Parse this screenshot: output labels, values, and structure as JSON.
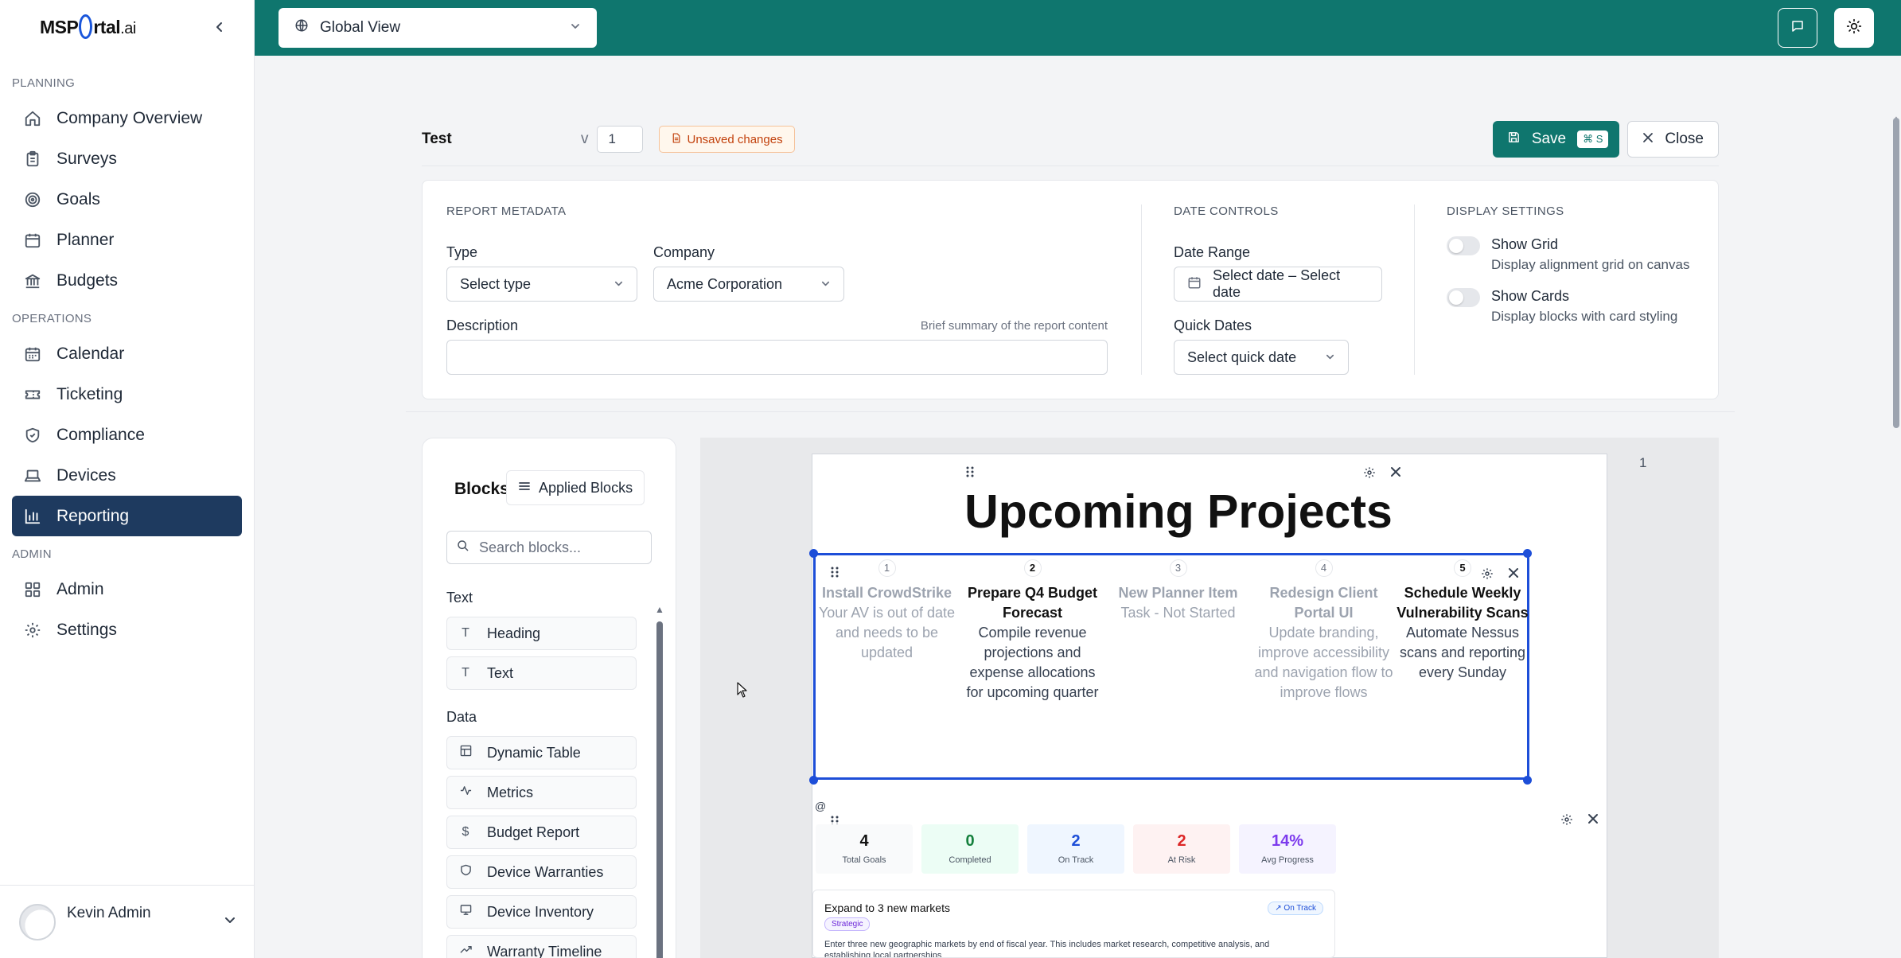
{
  "sidebar": {
    "logo": {
      "prefix": "MSP",
      "middle": "rtal",
      "suffix": ".ai"
    },
    "sections": {
      "planning": "PLANNING",
      "operations": "OPERATIONS",
      "admin": "ADMIN"
    },
    "items": [
      {
        "label": "Company Overview",
        "icon": "home-icon"
      },
      {
        "label": "Surveys",
        "icon": "clipboard-icon"
      },
      {
        "label": "Goals",
        "icon": "target-icon"
      },
      {
        "label": "Planner",
        "icon": "calendar-icon"
      },
      {
        "label": "Budgets",
        "icon": "bank-icon"
      },
      {
        "label": "Calendar",
        "icon": "calendar-icon"
      },
      {
        "label": "Ticketing",
        "icon": "ticket-icon"
      },
      {
        "label": "Compliance",
        "icon": "shield-icon"
      },
      {
        "label": "Devices",
        "icon": "laptop-icon"
      },
      {
        "label": "Reporting",
        "icon": "bar-chart-icon",
        "active": true
      },
      {
        "label": "Admin",
        "icon": "grid-icon"
      },
      {
        "label": "Settings",
        "icon": "gear-icon"
      }
    ],
    "user": {
      "name": "Kevin Admin"
    }
  },
  "topbar": {
    "view": "Global View",
    "accent": "#0f766e"
  },
  "report": {
    "title": "Test",
    "version_label": "v",
    "version": "1",
    "unsaved": "Unsaved changes",
    "save": "Save",
    "save_shortcut": "⌘ S",
    "close": "Close"
  },
  "metadata": {
    "section_title": "REPORT METADATA",
    "type_label": "Type",
    "type_value": "Select type",
    "company_label": "Company",
    "company_value": "Acme Corporation",
    "description_label": "Description",
    "description_hint": "Brief summary of the report content",
    "description_value": ""
  },
  "date_controls": {
    "section_title": "DATE CONTROLS",
    "range_label": "Date Range",
    "range_value": "Select date – Select date",
    "quick_label": "Quick Dates",
    "quick_value": "Select quick date"
  },
  "display_settings": {
    "section_title": "DISPLAY SETTINGS",
    "grid_title": "Show Grid",
    "grid_desc": "Display alignment grid on canvas",
    "grid_on": false,
    "cards_title": "Show Cards",
    "cards_desc": "Display blocks with card styling",
    "cards_on": false
  },
  "blocks_panel": {
    "title": "Blocks",
    "applied": "Applied Blocks",
    "search_placeholder": "Search blocks...",
    "groups": [
      {
        "label": "Text",
        "items": [
          "Heading",
          "Text"
        ]
      },
      {
        "label": "Data",
        "items": [
          "Dynamic Table",
          "Metrics",
          "Budget Report",
          "Device Warranties",
          "Device Inventory",
          "Warranty Timeline"
        ]
      }
    ]
  },
  "canvas": {
    "page_number": "1",
    "heading": "Upcoming Projects",
    "projects": [
      {
        "num": "1",
        "title": "Install CrowdStrike",
        "desc": "Your AV is out of date and needs to be updated",
        "muted": true
      },
      {
        "num": "2",
        "title": "Prepare Q4 Budget Forecast",
        "desc": "Compile revenue projections and expense allocations for upcoming quarter",
        "muted": false
      },
      {
        "num": "3",
        "title": "New Planner Item",
        "desc": "Task - Not Started",
        "muted": true
      },
      {
        "num": "4",
        "title": "Redesign Client Portal UI",
        "desc": "Update branding, improve accessibility and navigation flow to improve flows",
        "muted": true
      },
      {
        "num": "5",
        "title": "Schedule Weekly Vulnerability Scans",
        "desc": "Automate Nessus scans and reporting every Sunday",
        "muted": false
      }
    ],
    "metrics": [
      {
        "value": "4",
        "label": "Total Goals",
        "color": "#111111",
        "bg": "#f9fafb"
      },
      {
        "value": "0",
        "label": "Completed",
        "color": "#15803d",
        "bg": "#ecfdf5"
      },
      {
        "value": "2",
        "label": "On Track",
        "color": "#1d4ed8",
        "bg": "#eff6ff"
      },
      {
        "value": "2",
        "label": "At Risk",
        "color": "#dc2626",
        "bg": "#fef2f2"
      },
      {
        "value": "14%",
        "label": "Avg Progress",
        "color": "#7c3aed",
        "bg": "#f5f3ff"
      }
    ],
    "goal": {
      "title": "Expand to 3 new markets",
      "tag": "Strategic",
      "status": "↗ On Track",
      "desc": "Enter three new geographic markets by end of fiscal year. This includes market research, competitive analysis, and",
      "desc_cont": "establishing local partnerships"
    }
  }
}
